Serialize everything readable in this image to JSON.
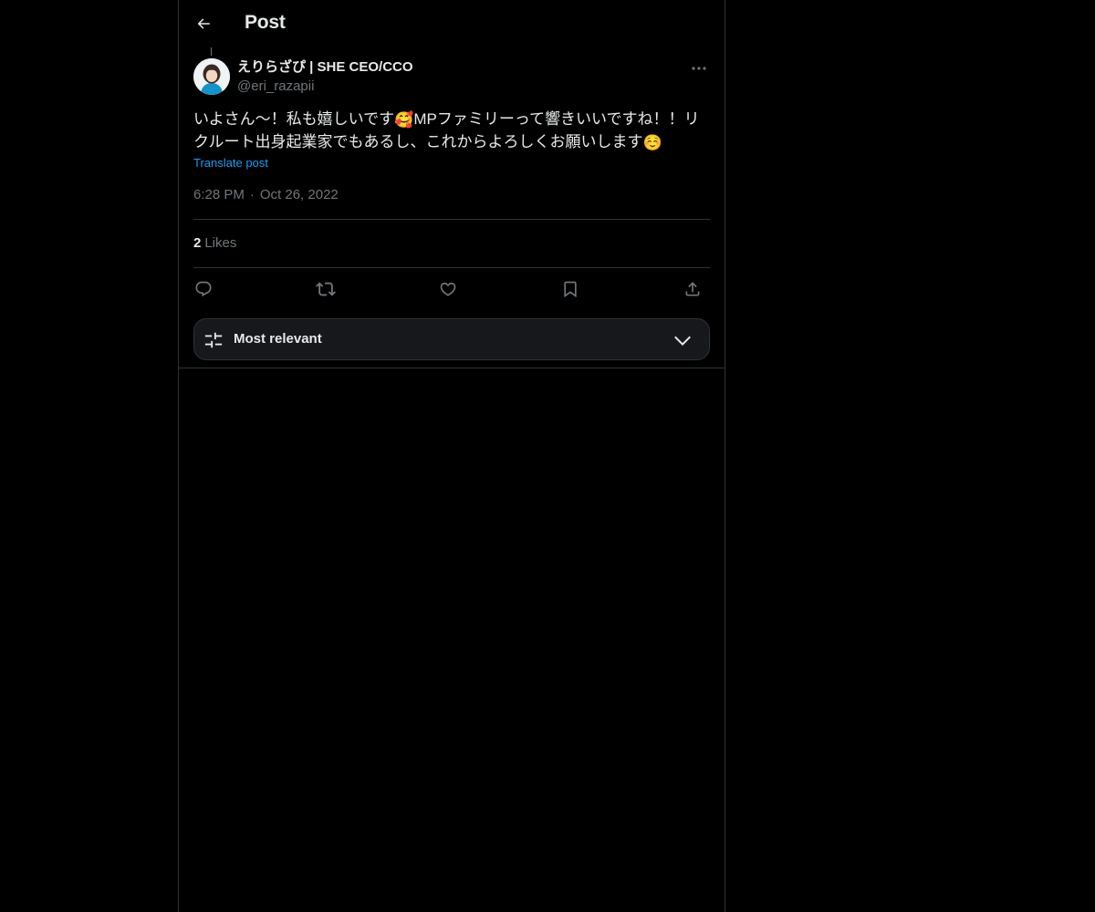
{
  "header": {
    "title": "Post",
    "back_icon": "arrow-left-icon"
  },
  "post": {
    "author": {
      "display_name": "えりらざぴ | SHE CEO/CCO",
      "handle": "@eri_razapii",
      "avatar_icon": "avatar-photo"
    },
    "text_parts": {
      "part1": "いよさん〜！私も嬉しいです",
      "emoji1": "🥰",
      "part2": "MPファミリーって響きいいですね！！リクルート出身起業家でもあるし、これからよろしくお願いします",
      "emoji2": "☺️"
    },
    "translate_label": "Translate post",
    "time": "6:28 PM",
    "separator": "·",
    "date": "Oct 26, 2022",
    "likes_count": "2",
    "likes_label": "Likes"
  },
  "actions": [
    "reply-icon",
    "repost-icon",
    "like-icon",
    "bookmark-icon",
    "share-icon"
  ],
  "sort": {
    "label": "Most relevant",
    "icon": "sliders-icon",
    "chevron": "chevron-down-icon"
  },
  "colors": {
    "background": "#000000",
    "text": "#e7e9ea",
    "secondary": "#71767b",
    "accent": "#1d9bf0",
    "border": "#2f3336"
  }
}
